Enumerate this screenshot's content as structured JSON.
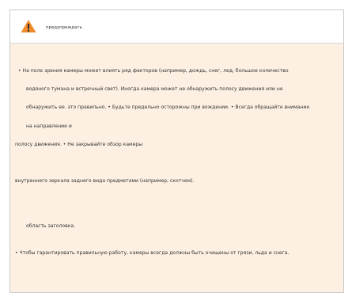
{
  "colors": {
    "panel_background": "#fdf0e2",
    "header_background": "#ffffff",
    "text": "#333333",
    "warning_triangle": "#ef8b2c",
    "warning_mark": "#2b2b2b",
    "border": "#c9c9c9"
  },
  "header": {
    "icon": "warning-triangle-icon",
    "title": "предупреждать"
  },
  "body": {
    "lines": [
      "• На поле зрения камеры может влиять ряд факторов (например, дождь, снег, лед, большое количество",
      "водяного тумана и встречный свет). Иногда камера может не обнаружить полосу движения или не",
      "обнаружить ее. это правильно. • Будьте предельно осторожны при вождении. • Всегда обращайте внимание",
      "на направление и",
      "полосу движения. • Не закрывайте обзор камеры",
      "внутреннего зеркала заднего вида предметами (например, скотчем).",
      "область заголовка.",
      "• Чтобы гарантировать правильную работу, камеры всегда должны быть очищены от грязи, льда и снега."
    ]
  }
}
